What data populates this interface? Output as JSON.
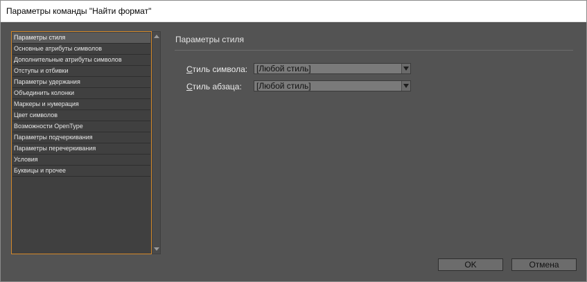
{
  "dialog": {
    "title": "Параметры команды \"Найти формат\""
  },
  "categories": {
    "items": [
      "Параметры стиля",
      "Основные атрибуты символов",
      "Дополнительные атрибуты символов",
      "Отступы и отбивки",
      "Параметры удержания",
      "Объединить колонки",
      "Маркеры и нумерация",
      "Цвет символов",
      "Возможности OpenType",
      "Параметры подчеркивания",
      "Параметры перечеркивания",
      "Условия",
      "Буквицы и прочее"
    ],
    "selected_index": 0
  },
  "panel": {
    "title": "Параметры стиля",
    "char_style": {
      "label_hotkey": "С",
      "label_rest": "тиль символа:",
      "value": "[Любой стиль]"
    },
    "para_style": {
      "label_hotkey": "С",
      "label_rest": "тиль абзаца:",
      "value": "[Любой стиль]"
    }
  },
  "buttons": {
    "ok": "OK",
    "cancel": "Отмена"
  },
  "colors": {
    "background": "#535353",
    "list_focus_border": "#d68a2a",
    "titlebar": "#ffffff"
  },
  "icons": {
    "scroll_up": "triangle-up",
    "scroll_down": "triangle-down",
    "dropdown": "triangle-down"
  }
}
